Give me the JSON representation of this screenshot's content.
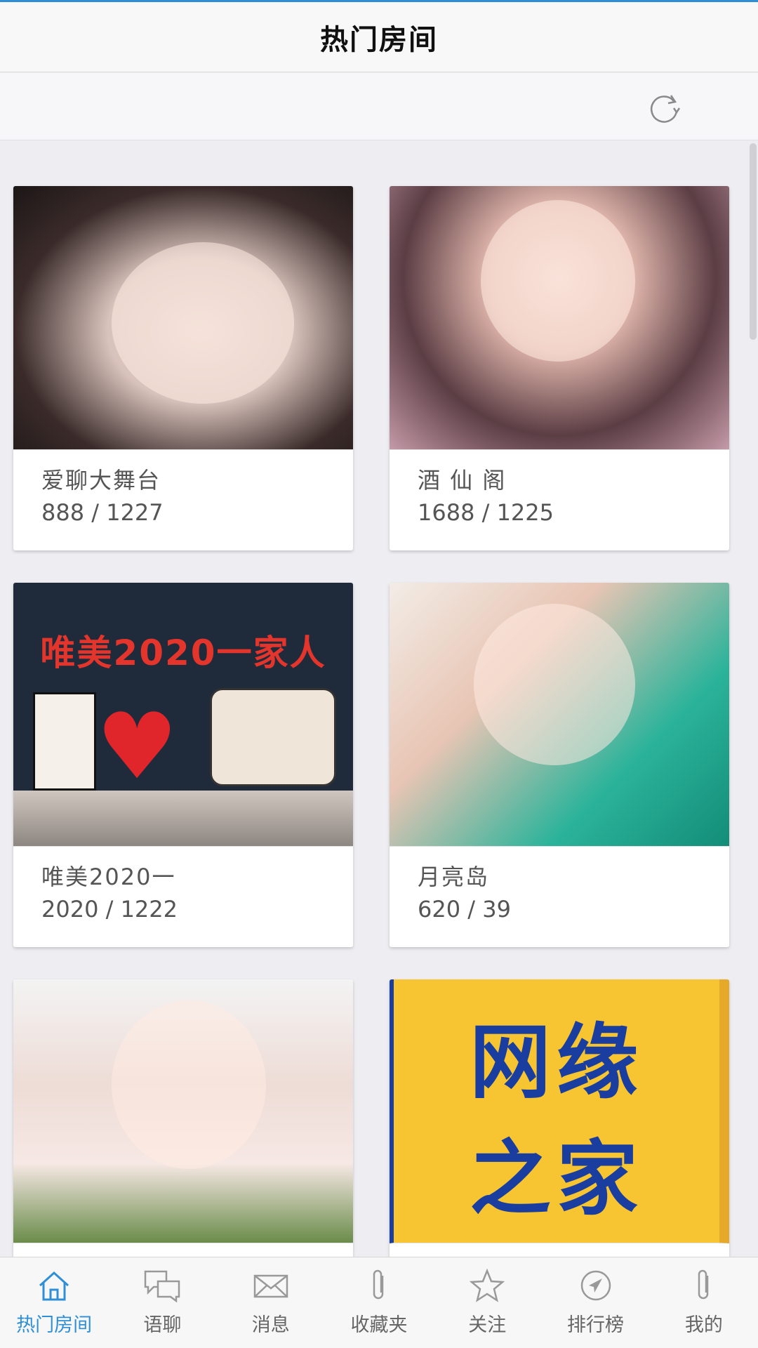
{
  "header": {
    "title": "热门房间"
  },
  "toolbar": {
    "refresh_icon": "refresh-icon"
  },
  "rooms": [
    {
      "name": "爱聊大舞台",
      "count": "888 / 1227"
    },
    {
      "name": "酒 仙 阁",
      "count": "1688 / 1225"
    },
    {
      "name": "唯美2020一",
      "count": "2020 / 1222",
      "poster_text": "唯美2020一家人"
    },
    {
      "name": "月亮岛",
      "count": "620 / 39"
    },
    {
      "name": "",
      "count": ""
    },
    {
      "name": "",
      "count": "",
      "poster_line1": "网缘",
      "poster_line2": "之家"
    }
  ],
  "tabbar": {
    "items": [
      {
        "label": "热门房间",
        "icon": "home-icon",
        "active": true
      },
      {
        "label": "语聊",
        "icon": "chat-bubbles-icon"
      },
      {
        "label": "消息",
        "icon": "mail-icon"
      },
      {
        "label": "收藏夹",
        "icon": "paperclip-icon"
      },
      {
        "label": "关注",
        "icon": "star-icon"
      },
      {
        "label": "排行榜",
        "icon": "compass-icon"
      },
      {
        "label": "我的",
        "icon": "paperclip-icon"
      }
    ]
  },
  "colors": {
    "accent": "#2f8fd6",
    "poster_yellow": "#f7c531",
    "poster_blue": "#1a3ea0"
  }
}
